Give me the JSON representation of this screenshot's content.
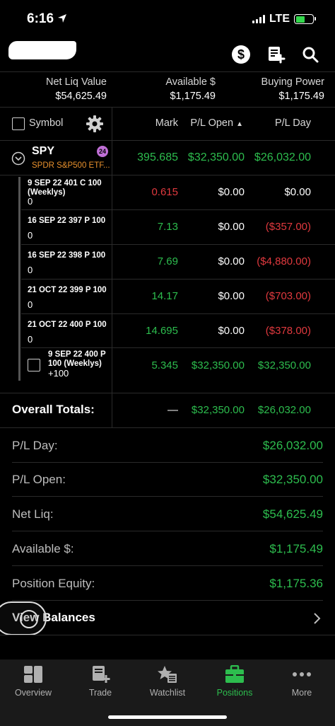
{
  "status": {
    "time": "6:16",
    "network": "LTE"
  },
  "header": {
    "icons": [
      "dollar-circle-icon",
      "trade-ticket-icon",
      "search-icon"
    ]
  },
  "summary": {
    "net_liq_label": "Net Liq Value",
    "net_liq_value": "$54,625.49",
    "available_label": "Available $",
    "available_value": "$1,175.49",
    "buying_power_label": "Buying Power",
    "buying_power_value": "$1,175.49"
  },
  "table": {
    "col_symbol": "Symbol",
    "col_mark": "Mark",
    "col_pl_open": "P/L Open",
    "col_pl_day": "P/L Day",
    "sort_indicator": "▲"
  },
  "position": {
    "symbol": "SPY",
    "badge": "24",
    "description": "SPDR S&P500 ETF...",
    "mark": "395.685",
    "pl_open": "$32,350.00",
    "pl_day": "$26,032.00"
  },
  "legs": [
    {
      "name": "9 SEP 22 401 C 100 (Weeklys)",
      "qty": "0",
      "mark": "0.615",
      "pl_open": "$0.00",
      "pl_day": "$0.00"
    },
    {
      "name": "16 SEP 22 397 P 100",
      "qty": "0",
      "mark": "7.13",
      "pl_open": "$0.00",
      "pl_day": "($357.00)"
    },
    {
      "name": "16 SEP 22 398 P 100",
      "qty": "0",
      "mark": "7.69",
      "pl_open": "$0.00",
      "pl_day": "($4,880.00)"
    },
    {
      "name": "21 OCT 22 399 P 100",
      "qty": "0",
      "mark": "14.17",
      "pl_open": "$0.00",
      "pl_day": "($703.00)"
    },
    {
      "name": "21 OCT 22 400 P 100",
      "qty": "0",
      "mark": "14.695",
      "pl_open": "$0.00",
      "pl_day": "($378.00)"
    },
    {
      "name": "9 SEP 22 400 P 100 (Weeklys)",
      "qty": "+100",
      "mark": "5.345",
      "pl_open": "$32,350.00",
      "pl_day": "$32,350.00"
    }
  ],
  "totals": {
    "label": "Overall Totals:",
    "mark": "—",
    "pl_open": "$32,350.00",
    "pl_day": "$26,032.00"
  },
  "balances": [
    {
      "label": "P/L Day:",
      "value": "$26,032.00"
    },
    {
      "label": "P/L Open:",
      "value": "$32,350.00"
    },
    {
      "label": "Net Liq:",
      "value": "$54,625.49"
    },
    {
      "label": "Available $:",
      "value": "$1,175.49"
    },
    {
      "label": "Position Equity:",
      "value": "$1,175.36"
    }
  ],
  "view_balances": "View Balances",
  "nav": [
    {
      "label": "Overview",
      "icon": "overview-icon"
    },
    {
      "label": "Trade",
      "icon": "trade-icon"
    },
    {
      "label": "Watchlist",
      "icon": "watchlist-icon"
    },
    {
      "label": "Positions",
      "icon": "positions-icon",
      "active": true
    },
    {
      "label": "More",
      "icon": "more-icon"
    }
  ],
  "colors": {
    "green": "#2dbd4e",
    "red": "#e0393e",
    "accent_orange": "#e8912d",
    "badge_purple": "#c06fd6"
  }
}
